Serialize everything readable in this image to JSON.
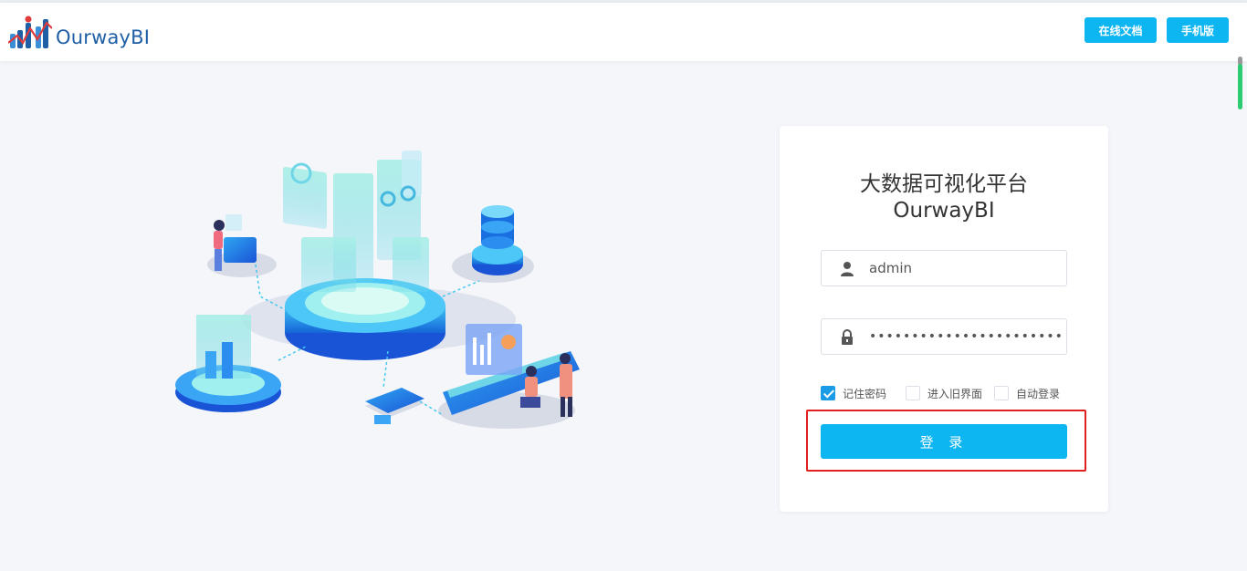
{
  "header": {
    "brand": "OurwayBI",
    "docs_button": "在线文档",
    "mobile_button": "手机版"
  },
  "login": {
    "title_cn": "大数据可视化平台",
    "title_en": "OurwayBI",
    "username": "admin",
    "password_mask": "••••••••••••••••••••••••••••",
    "checkboxes": [
      {
        "label": "记住密码",
        "checked": true
      },
      {
        "label": "进入旧界面",
        "checked": false
      },
      {
        "label": "自动登录",
        "checked": false
      }
    ],
    "submit": "登 录"
  },
  "colors": {
    "accent": "#0db6f0",
    "brand": "#1f5fa6",
    "highlight": "#e02020"
  },
  "icons": {
    "user": "user-icon",
    "lock": "lock-icon"
  }
}
